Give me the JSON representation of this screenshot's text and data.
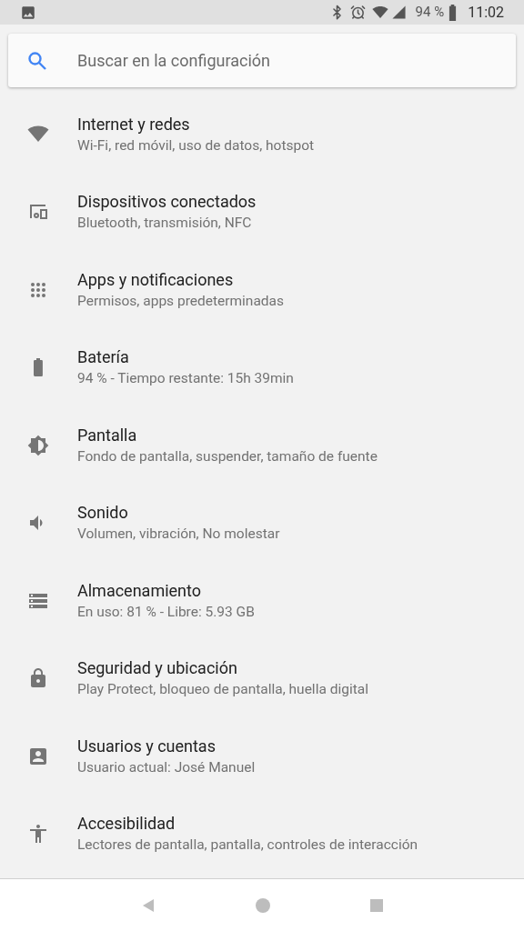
{
  "status_bar": {
    "battery": "94 %",
    "time": "11:02"
  },
  "search": {
    "placeholder": "Buscar en la configuración"
  },
  "items": [
    {
      "kind": "wifi",
      "title": "Internet y redes",
      "subtitle": "Wi-Fi, red móvil, uso de datos, hotspot"
    },
    {
      "kind": "devices",
      "title": "Dispositivos conectados",
      "subtitle": "Bluetooth, transmisión, NFC"
    },
    {
      "kind": "apps",
      "title": "Apps y notificaciones",
      "subtitle": "Permisos, apps predeterminadas"
    },
    {
      "kind": "battery",
      "title": "Batería",
      "subtitle": "94 % - Tiempo restante: 15h 39min"
    },
    {
      "kind": "display",
      "title": "Pantalla",
      "subtitle": "Fondo de pantalla, suspender, tamaño de fuente"
    },
    {
      "kind": "sound",
      "title": "Sonido",
      "subtitle": "Volumen, vibración, No molestar"
    },
    {
      "kind": "storage",
      "title": "Almacenamiento",
      "subtitle": "En uso: 81 % - Libre: 5.93 GB"
    },
    {
      "kind": "lock",
      "title": "Seguridad y ubicación",
      "subtitle": "Play Protect, bloqueo de pantalla, huella digital"
    },
    {
      "kind": "account",
      "title": "Usuarios y cuentas",
      "subtitle": "Usuario actual: José Manuel"
    },
    {
      "kind": "accessibility",
      "title": "Accesibilidad",
      "subtitle": "Lectores de pantalla, pantalla, controles de interacción"
    }
  ]
}
